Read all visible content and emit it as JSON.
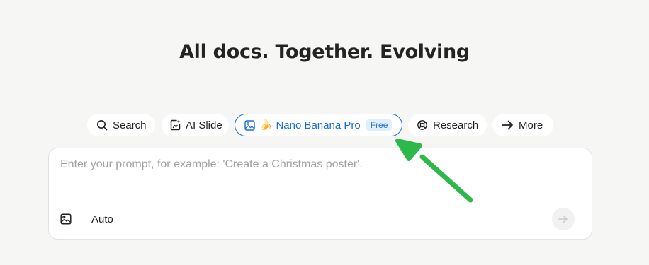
{
  "headline": "All docs. Together. Evolving",
  "modes": {
    "search": {
      "label": "Search",
      "icon": "search-icon"
    },
    "ai_slide": {
      "label": "AI Slide",
      "icon": "slide-icon"
    },
    "nano_banana": {
      "label": "Nano Banana Pro",
      "emoji": "🍌",
      "badge": "Free",
      "icon": "image-icon",
      "selected": true
    },
    "research": {
      "label": "Research",
      "icon": "research-icon"
    },
    "more": {
      "label": "More",
      "icon": "arrow-right-icon"
    }
  },
  "prompt": {
    "placeholder": "Enter your prompt, for example: 'Create a Christmas poster'.",
    "value": "",
    "model_selector": "Auto",
    "upload_icon": "image-icon",
    "send_icon": "arrow-right-icon"
  },
  "colors": {
    "page_background": "#f6f6f5",
    "selected_accent": "#1a6fd6",
    "annotation_arrow": "#2fb84a"
  }
}
